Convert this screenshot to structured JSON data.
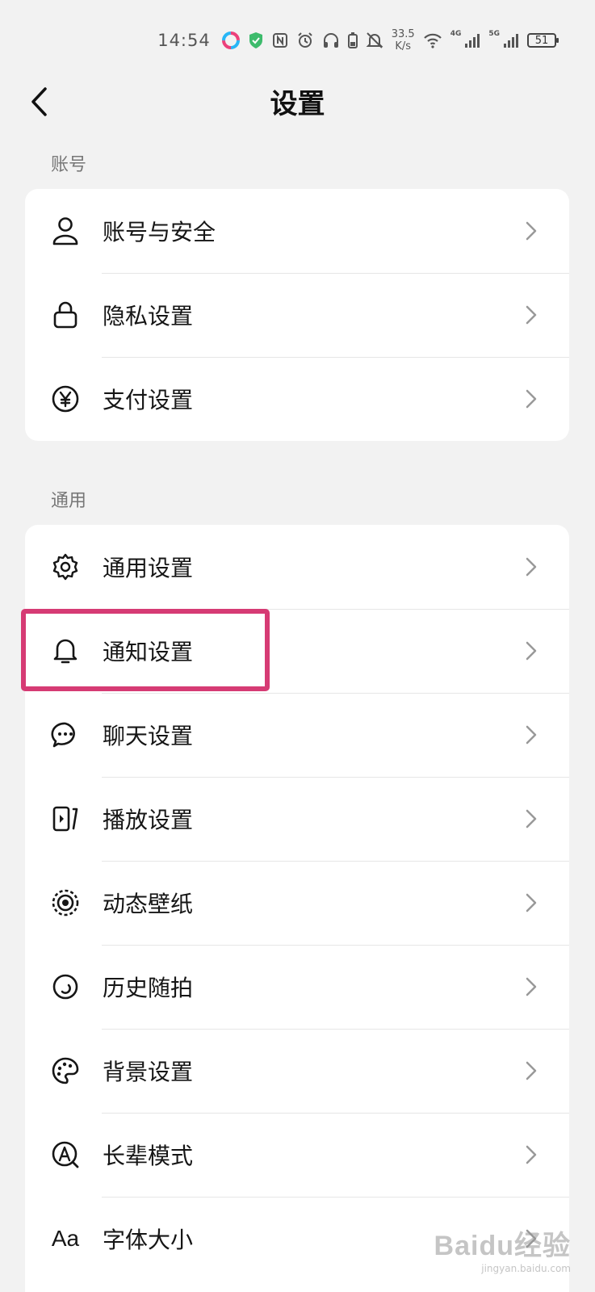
{
  "status_bar": {
    "time": "14:54",
    "speed_value": "33.5",
    "speed_unit": "K/s",
    "net_4g": "4G",
    "net_5g": "5G",
    "battery": "51",
    "icons": [
      "app-icon",
      "shield-icon",
      "nfc-icon",
      "alarm-icon",
      "headphones-icon",
      "battery-small-icon",
      "mute-icon",
      "wifi-icon",
      "signal-icon"
    ]
  },
  "header": {
    "title": "设置",
    "back_icon": "chevron-left-icon"
  },
  "sections": {
    "account": {
      "label": "账号",
      "items": [
        {
          "label": "账号与安全",
          "icon": "user-icon"
        },
        {
          "label": "隐私设置",
          "icon": "lock-icon"
        },
        {
          "label": "支付设置",
          "icon": "yen-icon"
        }
      ]
    },
    "general": {
      "label": "通用",
      "items": [
        {
          "label": "通用设置",
          "icon": "gear-icon"
        },
        {
          "label": "通知设置",
          "icon": "bell-icon"
        },
        {
          "label": "聊天设置",
          "icon": "chat-icon"
        },
        {
          "label": "播放设置",
          "icon": "play-icon"
        },
        {
          "label": "动态壁纸",
          "icon": "wallpaper-icon"
        },
        {
          "label": "历史随拍",
          "icon": "history-icon"
        },
        {
          "label": "背景设置",
          "icon": "palette-icon"
        },
        {
          "label": "长辈模式",
          "icon": "elder-mode-icon"
        },
        {
          "label": "字体大小",
          "icon": "font-size-icon",
          "glyph": "Aa"
        }
      ]
    }
  },
  "highlight": {
    "color": "#d63b74",
    "target": "通知设置"
  },
  "watermark": {
    "main": "Baidu经验",
    "sub": "jingyan.baidu.com"
  },
  "colors": {
    "background": "#f2f2f2",
    "card": "#ffffff",
    "text": "#161616",
    "secondary": "#777777",
    "chevron": "#999999"
  }
}
